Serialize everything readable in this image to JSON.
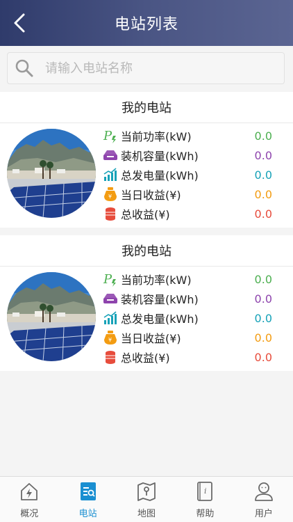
{
  "header": {
    "title": "电站列表",
    "back_icon": "chevron-left-icon"
  },
  "search": {
    "placeholder": "请输入电站名称",
    "value": ""
  },
  "colors": {
    "header": "#3d477a",
    "power": "#4caf50",
    "capacity": "#8e44ad",
    "generation": "#17a2b8",
    "daily_income": "#f39c12",
    "total_income": "#e74c3c",
    "tab_active": "#1a8fd1"
  },
  "stations": [
    {
      "name": "我的电站",
      "metrics": [
        {
          "label": "当前功率(kW)",
          "value": "0.0",
          "icon": "power-icon"
        },
        {
          "label": "装机容量(kWh)",
          "value": "0.0",
          "icon": "capacity-icon"
        },
        {
          "label": "总发电量(kWh)",
          "value": "0.0",
          "icon": "generation-chart-icon"
        },
        {
          "label": "当日收益(¥)",
          "value": "0.0",
          "icon": "money-bag-icon"
        },
        {
          "label": "总收益(¥)",
          "value": "0.0",
          "icon": "coin-stack-icon"
        }
      ]
    },
    {
      "name": "我的电站",
      "metrics": [
        {
          "label": "当前功率(kW)",
          "value": "0.0",
          "icon": "power-icon"
        },
        {
          "label": "装机容量(kWh)",
          "value": "0.0",
          "icon": "capacity-icon"
        },
        {
          "label": "总发电量(kWh)",
          "value": "0.0",
          "icon": "generation-chart-icon"
        },
        {
          "label": "当日收益(¥)",
          "value": "0.0",
          "icon": "money-bag-icon"
        },
        {
          "label": "总收益(¥)",
          "value": "0.0",
          "icon": "coin-stack-icon"
        }
      ]
    }
  ],
  "tabs": [
    {
      "label": "概况",
      "icon": "overview-house-icon",
      "active": false
    },
    {
      "label": "电站",
      "icon": "station-icon",
      "active": true
    },
    {
      "label": "地图",
      "icon": "map-icon",
      "active": false
    },
    {
      "label": "帮助",
      "icon": "help-book-icon",
      "active": false
    },
    {
      "label": "用户",
      "icon": "user-icon",
      "active": false
    }
  ]
}
